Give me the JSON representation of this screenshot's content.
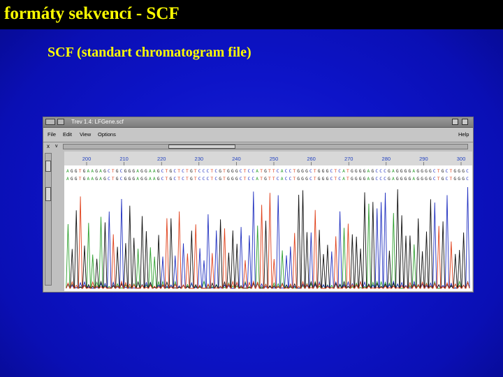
{
  "slide": {
    "title": "formáty sekvencí - SCF",
    "subtitle": "SCF (standart chromatogram file)"
  },
  "window": {
    "title": "Trev 1.4: LFGene.scf",
    "menu": [
      "File",
      "Edit",
      "View",
      "Options"
    ],
    "help": "Help",
    "toolbar_x": "x",
    "toolbar_v": "v"
  },
  "ruler": {
    "ticks": [
      "200",
      "210",
      "220",
      "230",
      "240",
      "250",
      "260",
      "270",
      "280",
      "290",
      "300"
    ]
  },
  "sequence": {
    "line1": "AGGTGAAGAGCTGCGGGAGGAAGCTGCTCTGTCCCTCGTGGGCTCCATGTTCACCTGGGCTGGGCTCATGGGGAGCCCGAGGGGAGGGGCTGCTGGGC",
    "line2": "AGGTGAAGAGCTGCGGGAGGAAGCTGCTCTGTCCCTCGTGGGCTCCATGTTCACCTGGGCTGGGCTCATGGGGAGCCCGAGGGGAGGGGCTGCTGGGC"
  },
  "colors": {
    "A": "#2ea02e",
    "C": "#2030c0",
    "G": "#111111",
    "T": "#e0401a",
    "title_text": "#ffff00",
    "background": "#0d14c8"
  }
}
